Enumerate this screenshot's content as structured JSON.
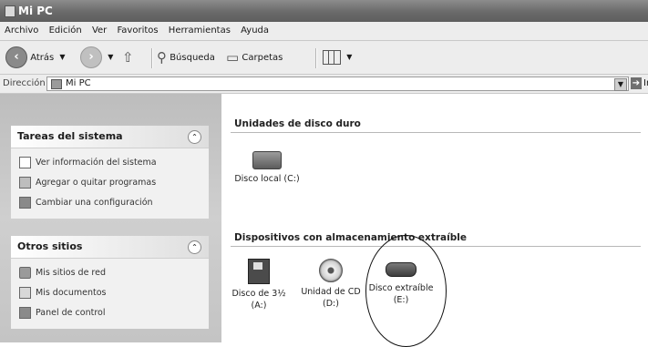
{
  "window": {
    "title": "Mi PC"
  },
  "menu": [
    "Archivo",
    "Edición",
    "Ver",
    "Favoritos",
    "Herramientas",
    "Ayuda"
  ],
  "toolbar": {
    "back": "Atrás",
    "search": "Búsqueda",
    "folders": "Carpetas"
  },
  "address": {
    "label": "Dirección",
    "value": "Mi PC",
    "go": "Ir"
  },
  "panels": {
    "system_tasks": {
      "title": "Tareas del sistema",
      "items": [
        "Ver información del sistema",
        "Agregar o quitar programas",
        "Cambiar una configuración"
      ]
    },
    "other_places": {
      "title": "Otros sitios",
      "items": [
        "Mis sitios de red",
        "Mis documentos",
        "Panel de control"
      ]
    }
  },
  "groups": {
    "hard_disks": {
      "title": "Unidades de disco duro",
      "items": [
        "Disco local (C:)"
      ]
    },
    "removable": {
      "title": "Dispositivos con almacenamiento extraíble",
      "items": [
        {
          "line1": "Disco de 3½",
          "line2": "(A:)"
        },
        {
          "line1": "Unidad de CD",
          "line2": "(D:)"
        },
        {
          "line1": "Disco extraíble",
          "line2": "(E:)"
        }
      ]
    }
  }
}
